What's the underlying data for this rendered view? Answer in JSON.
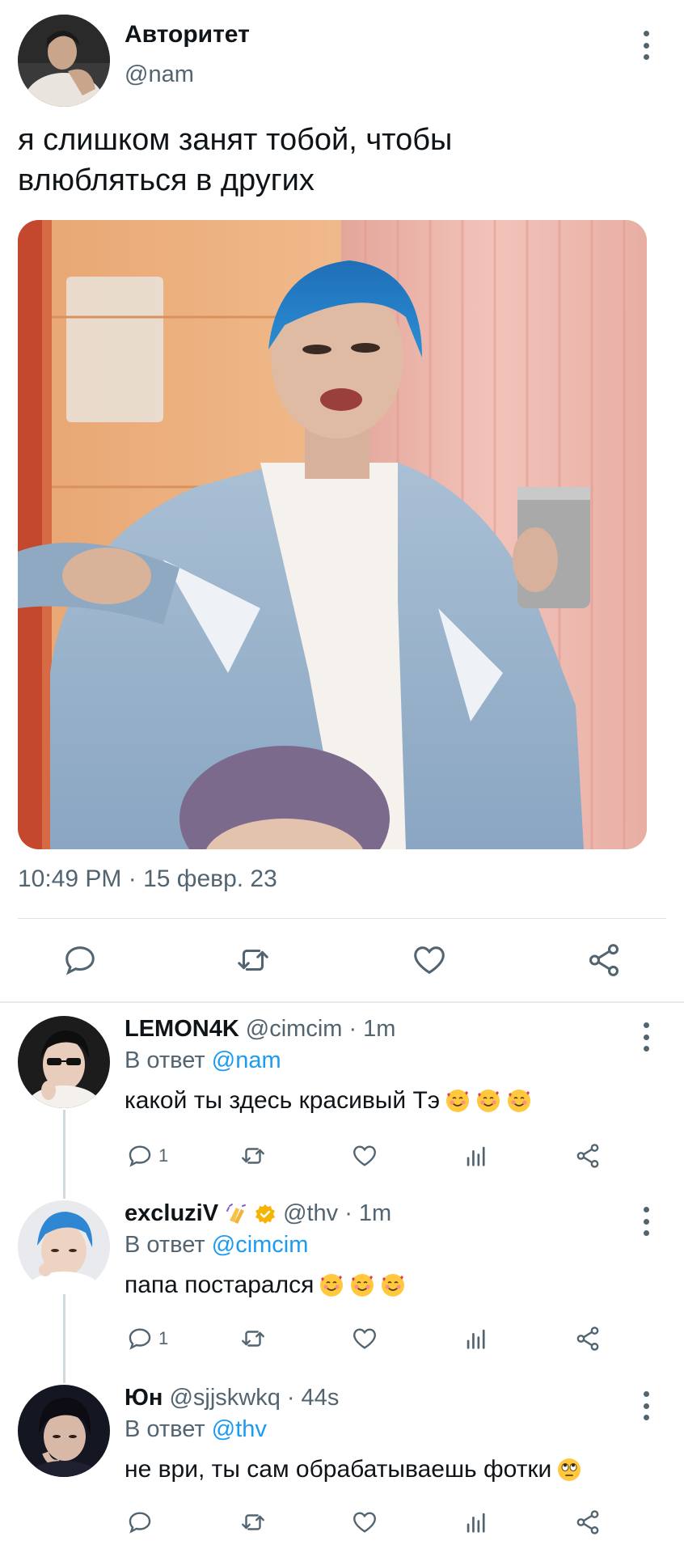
{
  "tweet": {
    "author_name": "Авторитет",
    "author_handle": "@nam",
    "text": "я слишком занят тобой,  чтобы\nвлюбляться  в других",
    "timestamp": "10:49 PM · 15 февр. 23",
    "icons": [
      "reply-icon",
      "retweet-icon",
      "like-icon",
      "share-icon"
    ]
  },
  "replies": [
    {
      "name": "LEMON4K",
      "handle": "@cimcim",
      "time": "· 1m",
      "reply_prefix": "В ответ",
      "reply_to": "@nam",
      "text": "какой ты здесь красивый Тэ",
      "emoji": [
        "smiling-face-with-hearts",
        "smiling-face-with-hearts",
        "smiling-face-with-hearts"
      ],
      "reply_count": "1"
    },
    {
      "name": "excluziV",
      "handle": "@thv",
      "time": "· 1m",
      "badges": [
        "waving-hands-emoji",
        "verified-badge-gold"
      ],
      "reply_prefix": "В ответ",
      "reply_to": "@cimcim",
      "text": "папа постарался",
      "emoji": [
        "smiling-face-with-hearts",
        "smiling-face-with-hearts",
        "smiling-face-with-hearts"
      ],
      "reply_count": "1"
    },
    {
      "name": "Юн",
      "handle": "@sjjskwkq",
      "time": "· 44s",
      "reply_prefix": "В ответ",
      "reply_to": "@thv",
      "text": "не ври, ты сам обрабатываешь фотки",
      "emoji": [
        "face-with-rolling-eyes"
      ],
      "reply_count": ""
    }
  ],
  "colors": {
    "text": "#0f1419",
    "secondary": "#536471",
    "accent": "#1d9bf0",
    "verified": "#f4b400"
  }
}
